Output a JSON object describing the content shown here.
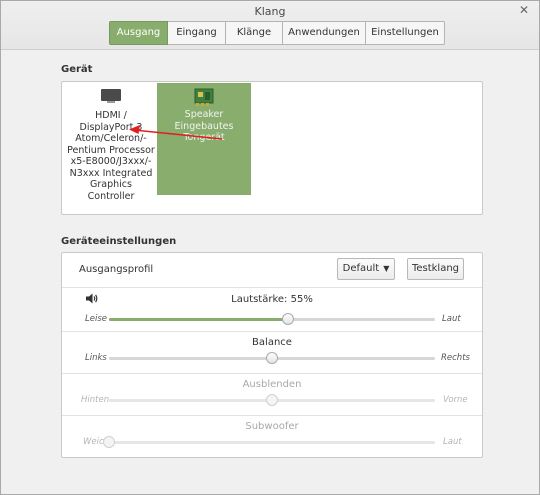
{
  "window": {
    "title": "Klang",
    "close_glyph": "✕"
  },
  "tabs": [
    {
      "label": "Ausgang",
      "active": true
    },
    {
      "label": "Eingang",
      "active": false
    },
    {
      "label": "Klänge",
      "active": false
    },
    {
      "label": "Anwendungen",
      "active": false
    },
    {
      "label": "Einstellungen",
      "active": false
    }
  ],
  "device_section": {
    "title": "Gerät",
    "devices": [
      {
        "icon": "monitor-icon",
        "label": "HDMI / DisplayPort 3 Atom/Celeron/-Pentium Processor x5-E8000/J3xxx/-N3xxx Integrated Graphics Controller",
        "selected": false
      },
      {
        "icon": "speaker-card-icon",
        "label": "Speaker Eingebautes Tongerät",
        "selected": true
      }
    ],
    "annotation_arrow_color": "#e02020"
  },
  "settings_section": {
    "title": "Geräteeinstellungen",
    "profile": {
      "label": "Ausgangsprofil",
      "select_value": "Default",
      "test_button": "Testklang"
    },
    "sliders": {
      "volume": {
        "icon": "speaker-volume-icon",
        "title": "Lautstärke: 55%",
        "left": "Leise",
        "right": "Laut",
        "value": 0.55,
        "enabled": true
      },
      "balance": {
        "title": "Balance",
        "left": "Links",
        "right": "Rechts",
        "value": 0.5,
        "enabled": true
      },
      "fade": {
        "title": "Ausblenden",
        "left": "Hinten",
        "right": "Vorne",
        "value": 0.5,
        "enabled": false
      },
      "subwoofer": {
        "title": "Subwoofer",
        "left": "Weich",
        "right": "Laut",
        "value": 0.0,
        "enabled": false
      }
    }
  },
  "colors": {
    "accent": "#88ad6d",
    "panel_bg": "#ffffff",
    "window_bg": "#f0f0f0"
  }
}
